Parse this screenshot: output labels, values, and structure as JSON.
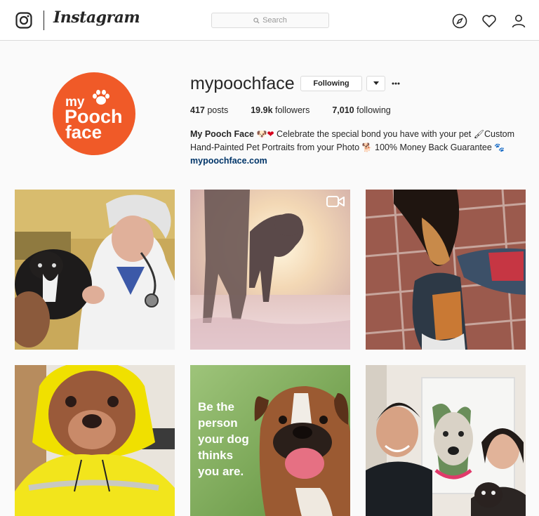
{
  "nav": {
    "wordmark": "Instagram",
    "search_placeholder": "Search",
    "icons": [
      "instagram-glyph-icon",
      "explore-compass-icon",
      "activity-heart-icon",
      "profile-person-icon"
    ]
  },
  "profile": {
    "username": "mypoochface",
    "follow_button_label": "Following",
    "avatar_logo": {
      "line1": "my",
      "line2": "Pooch",
      "line3": "face"
    },
    "brand_color": "#f05a28",
    "stats": {
      "posts_count": "417",
      "posts_label": "posts",
      "followers_count": "19.9k",
      "followers_label": "followers",
      "following_count": "7,010",
      "following_label": "following"
    },
    "bio": {
      "name": "My Pooch Face",
      "emoji1": "🐶",
      "emoji2": "❤",
      "text1": "Celebrate the special bond you have with your pet",
      "emoji3": "🖌",
      "text2": "Custom",
      "text3": "Hand-Painted Pet Portraits from your Photo",
      "emoji4": "🐕",
      "text4": "100% Money Back Guarantee",
      "emoji5": "🐾",
      "website": "mypoochface.com"
    }
  },
  "posts": [
    {
      "kind": "photo",
      "subject": "vet-with-dog"
    },
    {
      "kind": "video",
      "subject": "dog-at-sunset",
      "badge": "video-camera-icon"
    },
    {
      "kind": "photo",
      "subject": "dog-paw-and-sneakers"
    },
    {
      "kind": "photo",
      "subject": "pitbull-in-raincoat"
    },
    {
      "kind": "photo",
      "subject": "boxer-quote",
      "overlay_lines": [
        "Be the",
        "person",
        "your dog",
        "thinks",
        "you are."
      ]
    },
    {
      "kind": "photo",
      "subject": "couple-with-portrait"
    }
  ],
  "colors": {
    "text": "#262626",
    "link": "#003569",
    "border": "#dbdbdb",
    "background": "#fafafa"
  }
}
